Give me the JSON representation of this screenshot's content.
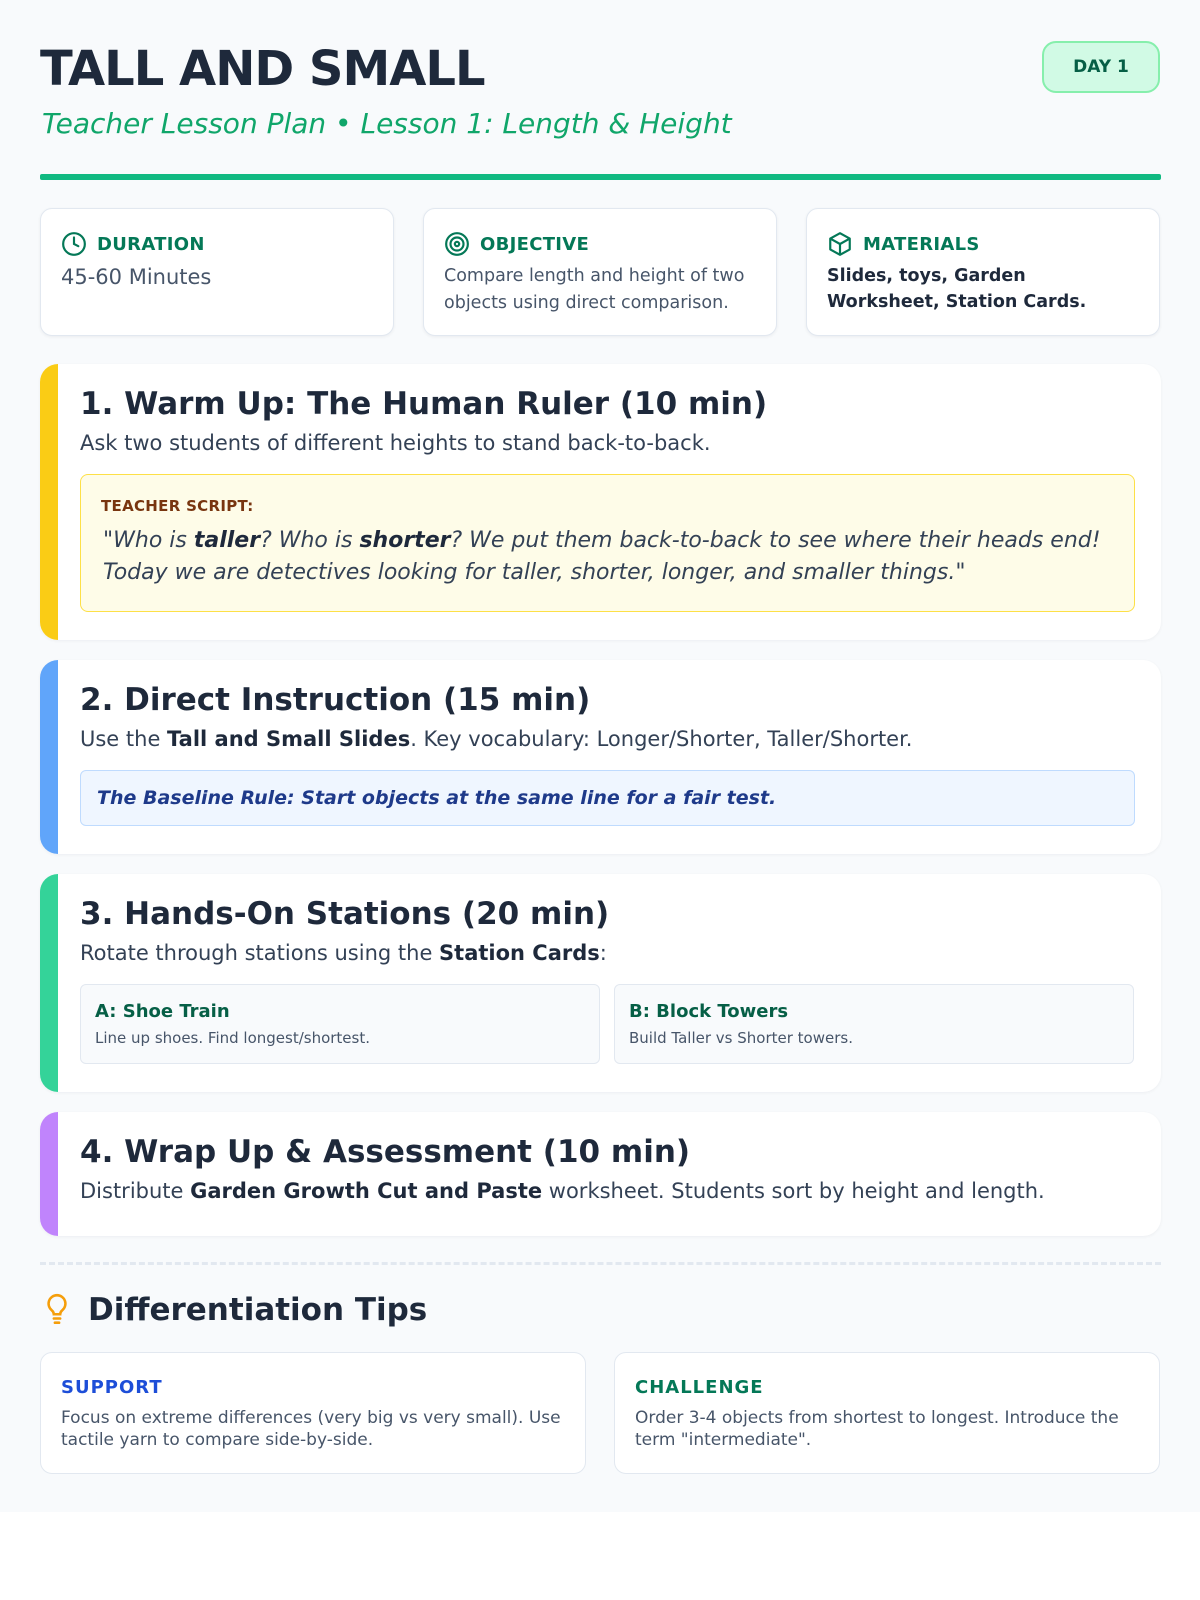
{
  "header": {
    "title": "TALL AND SMALL",
    "subtitle": "Teacher Lesson Plan • Lesson 1: Length & Height",
    "day_badge": "DAY 1"
  },
  "info_cards": {
    "duration": {
      "label": "DURATION",
      "value": "45-60 Minutes",
      "icon": "clock-icon"
    },
    "objective": {
      "label": "OBJECTIVE",
      "value": "Compare length and height of two objects using direct comparison.",
      "icon": "target-icon"
    },
    "materials": {
      "label": "MATERIALS",
      "value": "Slides, toys, Garden Worksheet, Station Cards.",
      "icon": "box-icon"
    }
  },
  "sections": {
    "warmup": {
      "title": "1. Warm Up: The Human Ruler (10 min)",
      "lead": "Ask two students of different heights to stand back-to-back.",
      "script_label": "TEACHER SCRIPT:",
      "script_open": "\"Who is ",
      "script_b1": "taller",
      "script_mid": "? Who is ",
      "script_b2": "shorter",
      "script_close": "? We put them back-to-back to see where their heads end! Today we are detectives looking for taller, shorter, longer, and smaller things.\"",
      "accent": "#facc15"
    },
    "instruction": {
      "title": "2. Direct Instruction (15 min)",
      "lead_pre": "Use the ",
      "lead_bold": "Tall and Small Slides",
      "lead_post": ". Key vocabulary: Longer/Shorter, Taller/Shorter.",
      "rule": "The Baseline Rule: Start objects at the same line for a fair test.",
      "accent": "#60a5fa"
    },
    "stations": {
      "title": "3. Hands-On Stations (20 min)",
      "lead_pre": "Rotate through stations using the ",
      "lead_bold": "Station Cards",
      "lead_post": ":",
      "items": [
        {
          "title": "A: Shoe Train",
          "desc": "Line up shoes. Find longest/shortest."
        },
        {
          "title": "B: Block Towers",
          "desc": "Build Taller vs Shorter towers."
        }
      ],
      "accent": "#34d399"
    },
    "wrapup": {
      "title": "4. Wrap Up & Assessment (10 min)",
      "lead_pre": "Distribute ",
      "lead_bold": "Garden Growth Cut and Paste",
      "lead_post": " worksheet. Students sort by height and length.",
      "accent": "#c084fc"
    }
  },
  "differentiation": {
    "title": "Differentiation Tips",
    "icon": "lightbulb-icon",
    "support": {
      "label": "SUPPORT",
      "text": "Focus on extreme differences (very big vs very small). Use tactile yarn to compare side-by-side.",
      "color": "#1d4ed8"
    },
    "challenge": {
      "label": "CHALLENGE",
      "text": "Order 3-4 objects from shortest to longest. Introduce the term \"intermediate\".",
      "color": "#047857"
    }
  }
}
